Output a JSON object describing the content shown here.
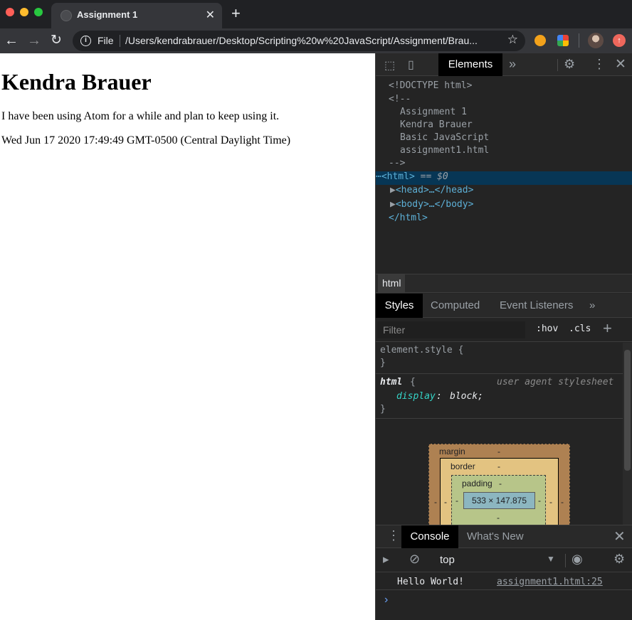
{
  "browser": {
    "tab_title": "Assignment 1",
    "tab_close": "✕",
    "new_tab": "+",
    "address_scheme": "File",
    "address_url": "/Users/kendrabrauer/Desktop/Scripting%20w%20JavaScript/Assignment/Brau..."
  },
  "page": {
    "heading": "Kendra Brauer",
    "paragraph": "I have been using Atom for a while and plan to keep using it.",
    "date_line": "Wed Jun 17 2020 17:49:49 GMT-0500 (Central Daylight Time)"
  },
  "devtools": {
    "main_tab": "Elements",
    "dom": {
      "doctype": "<!DOCTYPE html>",
      "comment_open": "<!--",
      "comment_lines": [
        "Assignment 1",
        "Kendra Brauer",
        "Basic JavaScript",
        "assignment1.html"
      ],
      "comment_close": "-->",
      "html_open": "<html>",
      "html_selected_suffix": "== $0",
      "head_node": "<head>…</head>",
      "body_node": "<body>…</body>",
      "html_close": "</html>"
    },
    "breadcrumb": "html",
    "sub_tabs": [
      "Styles",
      "Computed",
      "Event Listeners"
    ],
    "filter_placeholder": "Filter",
    "hov": ":hov",
    "cls": ".cls",
    "styles": {
      "element_style_open": "element.style {",
      "brace_close": "}",
      "html_selector": "html",
      "brace_open": "{",
      "ua_label": "user agent stylesheet",
      "prop_name": "display",
      "prop_value": "block;"
    },
    "box_model": {
      "margin_label": "margin",
      "border_label": "border",
      "padding_label": "padding",
      "dash": "-",
      "content_size": "533 × 147.875"
    },
    "drawer": {
      "console_tab": "Console",
      "whats_new_tab": "What's New",
      "context": "top",
      "message": "Hello World!",
      "message_source": "assignment1.html:25"
    }
  }
}
